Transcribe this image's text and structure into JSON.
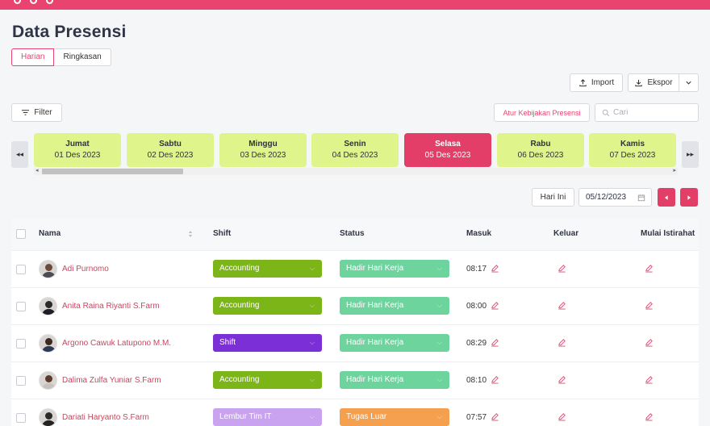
{
  "header": {
    "title": "Data Presensi"
  },
  "tabs": [
    {
      "label": "Harian",
      "active": true
    },
    {
      "label": "Ringkasan",
      "active": false
    }
  ],
  "toolbar": {
    "import_label": "Import",
    "export_label": "Ekspor",
    "filter_label": "Filter",
    "policy_label": "Atur Kebijakan Presensi",
    "search_placeholder": "Cari"
  },
  "days": [
    {
      "name": "Jumat",
      "date": "01 Des 2023",
      "active": false
    },
    {
      "name": "Sabtu",
      "date": "02 Des 2023",
      "active": false
    },
    {
      "name": "Minggu",
      "date": "03 Des 2023",
      "active": false
    },
    {
      "name": "Senin",
      "date": "04 Des 2023",
      "active": false
    },
    {
      "name": "Selasa",
      "date": "05 Des 2023",
      "active": true
    },
    {
      "name": "Rabu",
      "date": "06 Des 2023",
      "active": false
    },
    {
      "name": "Kamis",
      "date": "07 Des 2023",
      "active": false
    }
  ],
  "date_controls": {
    "today_label": "Hari Ini",
    "date_value": "05/12/2023"
  },
  "table": {
    "columns": [
      "Nama",
      "Shift",
      "Status",
      "Masuk",
      "Keluar",
      "Mulai Istirahat"
    ],
    "rows": [
      {
        "name": "Adi Purnomo",
        "shift": "Accounting",
        "status": "Hadir Hari Kerja",
        "masuk": "08:17"
      },
      {
        "name": "Anita Raina Riyanti S.Farm",
        "shift": "Accounting",
        "status": "Hadir Hari Kerja",
        "masuk": "08:00"
      },
      {
        "name": "Argono Cawuk Latupono M.M.",
        "shift": "Shift",
        "status": "Hadir Hari Kerja",
        "masuk": "08:29"
      },
      {
        "name": "Dalima Zulfa Yuniar S.Farm",
        "shift": "Accounting",
        "status": "Hadir Hari Kerja",
        "masuk": "08:10"
      },
      {
        "name": "Dariati Haryanto S.Farm",
        "shift": "Lembur Tim IT",
        "status": "Tugas Luar",
        "masuk": "07:57"
      }
    ]
  },
  "colors": {
    "accent": "#e8446f",
    "shift_accounting": "#7cb518",
    "shift_shift": "#7b2fd6",
    "shift_lembur": "#c9a3f0",
    "status_hadir": "#6dd49e",
    "status_tugas": "#f5a04e",
    "day_default": "#dff48a"
  }
}
